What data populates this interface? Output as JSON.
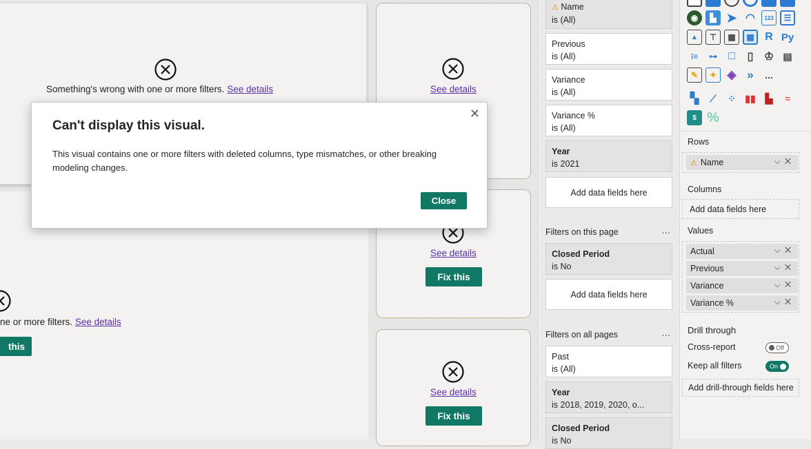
{
  "canvas": {
    "error_message": "Something's wrong with one or more filters.",
    "error_message_partial": "ne or more filters.",
    "see_details": "See details",
    "fix_this": "Fix this",
    "fix_this_partial": "this"
  },
  "dialog": {
    "title": "Can't display this visual.",
    "body": "This visual contains one or more filters with deleted columns, type mismatches, or other breaking modeling changes.",
    "close_button": "Close",
    "close_icon": "close-icon"
  },
  "filters": {
    "visual_cards": [
      {
        "title": "Name",
        "value": "is (All)",
        "warning": true
      },
      {
        "title": "Previous",
        "value": "is (All)"
      },
      {
        "title": "Variance",
        "value": "is (All)"
      },
      {
        "title": "Variance %",
        "value": "is (All)"
      },
      {
        "title": "Year",
        "value": "is 2021"
      }
    ],
    "add_fields": "Add data fields here",
    "page_section": "Filters on this page",
    "page_cards": [
      {
        "title": "Closed Period",
        "value": "is No"
      }
    ],
    "all_section": "Filters on all pages",
    "all_cards": [
      {
        "title": "Past",
        "value": "is (All)"
      },
      {
        "title": "Year",
        "value": "is 2018, 2019, 2020, o..."
      },
      {
        "title": "Closed Period",
        "value": "is No"
      }
    ],
    "more": "..."
  },
  "visualizations": {
    "gallery_icons": [
      "map-icon",
      "filled-map-icon",
      "azure-map-icon",
      "gauge-icon",
      "card-icon",
      "multirow-card-icon",
      "kpi-icon",
      "slicer-icon",
      "table-icon",
      "matrix-icon",
      "r-visual-icon",
      "python-visual-icon",
      "key-influencers-icon",
      "decomposition-tree-icon",
      "qa-icon",
      "paginated-report-icon",
      "trophy-icon",
      "report-icon",
      "smart-narrative-icon",
      "power-apps-icon",
      "power-automate-icon",
      "power-automate-flow-icon",
      "more-icon",
      "custom-visual-1-icon",
      "line-chart-icon",
      "scatter-icon",
      "bar-chart-icon",
      "waterfall-icon",
      "ribbon-icon",
      "table-calc-icon",
      "percent-icon"
    ],
    "python_label": "Py",
    "r_label": "R",
    "more_label": "...",
    "percent_label": "%",
    "rows_label": "Rows",
    "rows": [
      {
        "name": "Name",
        "warning": true
      }
    ],
    "columns_label": "Columns",
    "columns_add": "Add data fields here",
    "values_label": "Values",
    "values": [
      "Actual",
      "Previous",
      "Variance",
      "Variance %"
    ],
    "drill_label": "Drill through",
    "cross_report": "Cross-report",
    "cross_report_state": "Off",
    "keep_filters": "Keep all filters",
    "keep_filters_state": "On",
    "drill_add": "Add drill-through fields here",
    "accent": "#117865"
  }
}
